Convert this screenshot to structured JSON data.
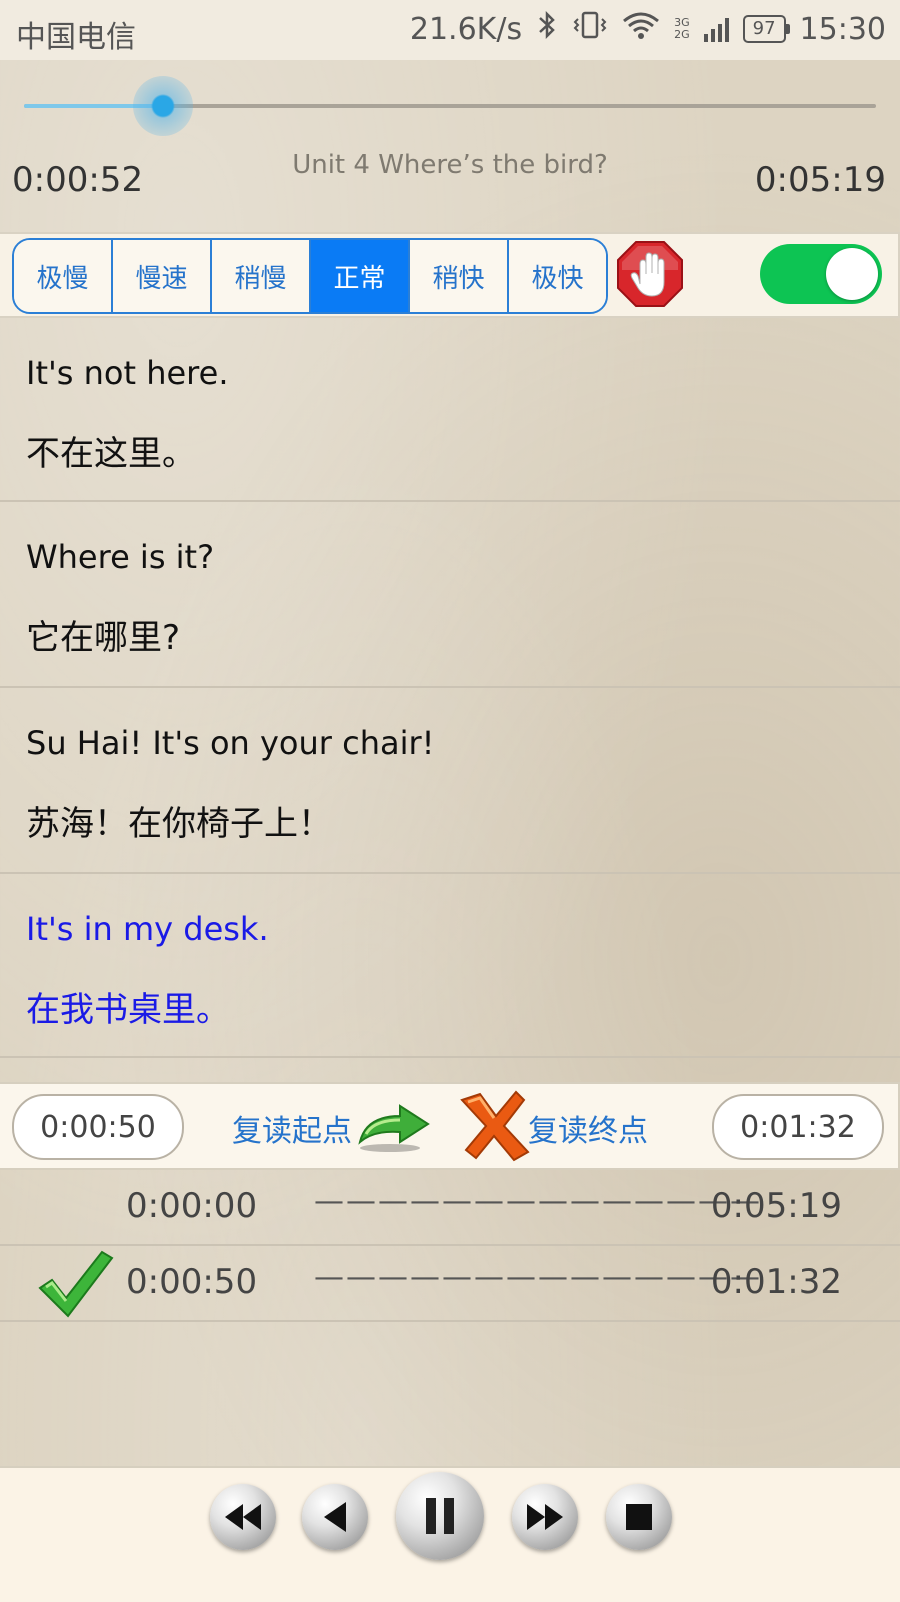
{
  "status_bar": {
    "carrier": "中国电信",
    "speed": "21.6K/s",
    "net_3g": "3G",
    "net_2g": "2G",
    "battery": "97",
    "time": "15:30"
  },
  "player": {
    "current_time": "0:00:52",
    "total_time": "0:05:19",
    "track_title": "Unit 4 Where’s the bird?",
    "progress_fraction": 0.163
  },
  "speed": {
    "options": [
      "极慢",
      "慢速",
      "稍慢",
      "正常",
      "稍快",
      "极快"
    ],
    "selected_index": 3,
    "auto_toggle_on": true
  },
  "sentences": [
    {
      "en": "It's not here.",
      "zh": "不在这里。"
    },
    {
      "en": "Where is it?",
      "zh": "它在哪里?"
    },
    {
      "en": "Su Hai! It's on your chair!",
      "zh": "苏海！在你椅子上！"
    },
    {
      "en": "It's in my desk.",
      "zh": "在我书桌里。"
    }
  ],
  "current_sentence_index": 3,
  "repeat": {
    "start_time": "0:00:50",
    "start_label": "复读起点",
    "end_label": "复读终点",
    "end_time": "0:01:32"
  },
  "ab_list": [
    {
      "start": "0:00:00",
      "dash": "——————————————",
      "end": "0:05:19",
      "checked": false
    },
    {
      "start": "0:00:50",
      "dash": "——————————————",
      "end": "0:01:32",
      "checked": true
    }
  ],
  "controls": [
    "rewind-icon",
    "previous-icon",
    "pause-icon",
    "fast-forward-icon",
    "stop-icon"
  ],
  "colors": {
    "accent_blue": "#0a7bf5",
    "highlight_text": "#1a1ae6",
    "toggle_green": "#0dc453"
  }
}
